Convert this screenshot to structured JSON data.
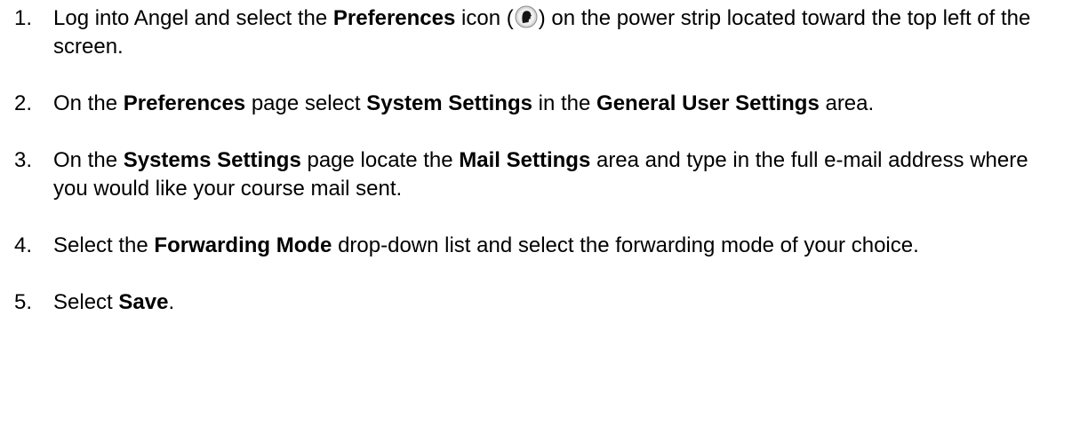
{
  "steps": [
    {
      "number": "1.",
      "parts": [
        {
          "text": "Log into Angel and select the "
        },
        {
          "text": "Preferences",
          "bold": true
        },
        {
          "text": " icon ("
        },
        {
          "icon": "preferences-icon"
        },
        {
          "text": ") on the power strip located toward the top left of the screen."
        }
      ]
    },
    {
      "number": "2.",
      "parts": [
        {
          "text": "On the "
        },
        {
          "text": "Preferences",
          "bold": true
        },
        {
          "text": " page select "
        },
        {
          "text": "System Settings",
          "bold": true
        },
        {
          "text": " in the "
        },
        {
          "text": "General User Settings",
          "bold": true
        },
        {
          "text": " area."
        }
      ]
    },
    {
      "number": "3.",
      "parts": [
        {
          "text": "On the "
        },
        {
          "text": "Systems Settings",
          "bold": true
        },
        {
          "text": " page locate the "
        },
        {
          "text": "Mail Settings",
          "bold": true
        },
        {
          "text": " area and type in the full e-mail address where you would like your course mail sent."
        }
      ]
    },
    {
      "number": "4.",
      "parts": [
        {
          "text": "Select the "
        },
        {
          "text": "Forwarding Mode",
          "bold": true
        },
        {
          "text": " drop-down list and select the forwarding mode of your choice."
        }
      ]
    },
    {
      "number": "5.",
      "parts": [
        {
          "text": "Select "
        },
        {
          "text": "Save",
          "bold": true
        },
        {
          "text": "."
        }
      ]
    }
  ]
}
